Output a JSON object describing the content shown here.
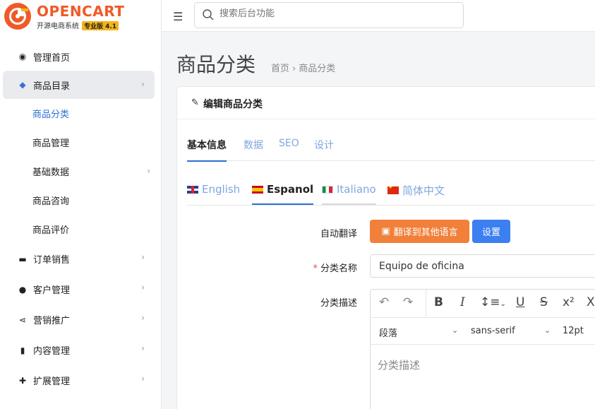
{
  "brand": {
    "name": "OPENCART",
    "subtitle": "开源电商系统",
    "badge": "专业版 4.1",
    "accent_color": "#f05a28"
  },
  "search": {
    "placeholder": "搜索后台功能"
  },
  "sidebar": {
    "items": [
      {
        "label": "管理首页",
        "icon": "dashboard-icon"
      },
      {
        "label": "商品目录",
        "icon": "tags-icon",
        "active": true
      },
      {
        "label": "订单销售",
        "icon": "cart-icon"
      },
      {
        "label": "客户管理",
        "icon": "user-icon"
      },
      {
        "label": "营销推广",
        "icon": "share-icon"
      },
      {
        "label": "内容管理",
        "icon": "book-icon"
      },
      {
        "label": "扩展管理",
        "icon": "puzzle-icon"
      }
    ],
    "subitems": [
      {
        "label": "商品分类",
        "current": true
      },
      {
        "label": "商品管理"
      },
      {
        "label": "基础数据",
        "has_children": true
      },
      {
        "label": "商品咨询"
      },
      {
        "label": "商品评价"
      }
    ]
  },
  "page": {
    "title": "商品分类",
    "breadcrumb": [
      "首页",
      "商品分类"
    ]
  },
  "card": {
    "title": "编辑商品分类",
    "tabs": [
      "基本信息",
      "数据",
      "SEO",
      "设计"
    ],
    "active_tab": "基本信息",
    "languages": [
      "English",
      "Espanol",
      "Italiano",
      "简体中文"
    ],
    "active_language": "Espanol"
  },
  "form": {
    "auto_translate_label": "自动翻译",
    "translate_button": "翻译到其他语言",
    "settings_button": "设置",
    "name_label": "分类名称",
    "name_value": "Equipo de oficina",
    "desc_label": "分类描述",
    "editor": {
      "paragraph": "段落",
      "font": "sans-serif",
      "size": "12pt",
      "placeholder": "分类描述"
    }
  }
}
